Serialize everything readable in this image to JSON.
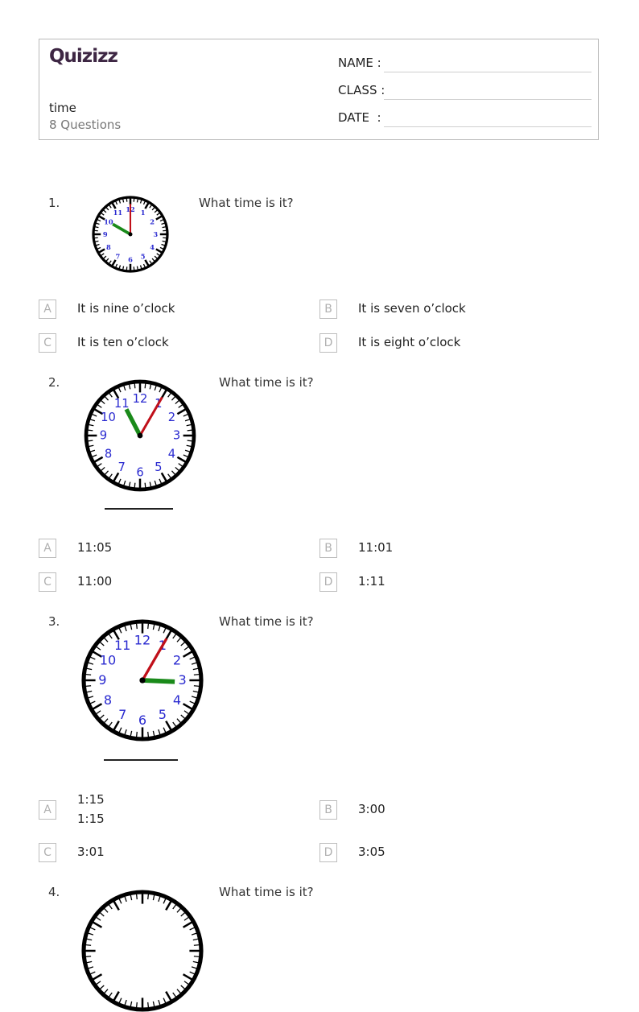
{
  "header": {
    "logo": "Quizizz",
    "title": "time",
    "question_count": "8 Questions",
    "fields": [
      {
        "label": "NAME :"
      },
      {
        "label": "CLASS :"
      },
      {
        "label": "DATE  :"
      }
    ]
  },
  "colors": {
    "brand": "#3d2643",
    "hour_hand": "#1a8a1a",
    "minute_hand": "#c0101a",
    "numerals": "#2a2ad0"
  },
  "questions": [
    {
      "number": "1.",
      "text": "What time is it?",
      "clock": {
        "hour": 10,
        "minute": 0,
        "style": "serif"
      },
      "options": [
        {
          "letter": "A",
          "text": "It is nine o’clock"
        },
        {
          "letter": "B",
          "text": "It is seven o’clock"
        },
        {
          "letter": "C",
          "text": "It is ten o’clock"
        },
        {
          "letter": "D",
          "text": "It is eight o’clock"
        }
      ]
    },
    {
      "number": "2.",
      "text": "What time is it?",
      "clock": {
        "hour": 11,
        "minute": 5,
        "style": "sans"
      },
      "options": [
        {
          "letter": "A",
          "text": "11:05"
        },
        {
          "letter": "B",
          "text": "11:01"
        },
        {
          "letter": "C",
          "text": "11:00"
        },
        {
          "letter": "D",
          "text": "1:11"
        }
      ]
    },
    {
      "number": "3.",
      "text": "What time is it?",
      "clock": {
        "hour": 3,
        "minute": 5,
        "style": "sans"
      },
      "options": [
        {
          "letter": "A",
          "text": "1:15",
          "text2": "1:15"
        },
        {
          "letter": "B",
          "text": "3:00"
        },
        {
          "letter": "C",
          "text": "3:01"
        },
        {
          "letter": "D",
          "text": "3:05"
        }
      ]
    },
    {
      "number": "4.",
      "text": "What time is it?"
    }
  ]
}
